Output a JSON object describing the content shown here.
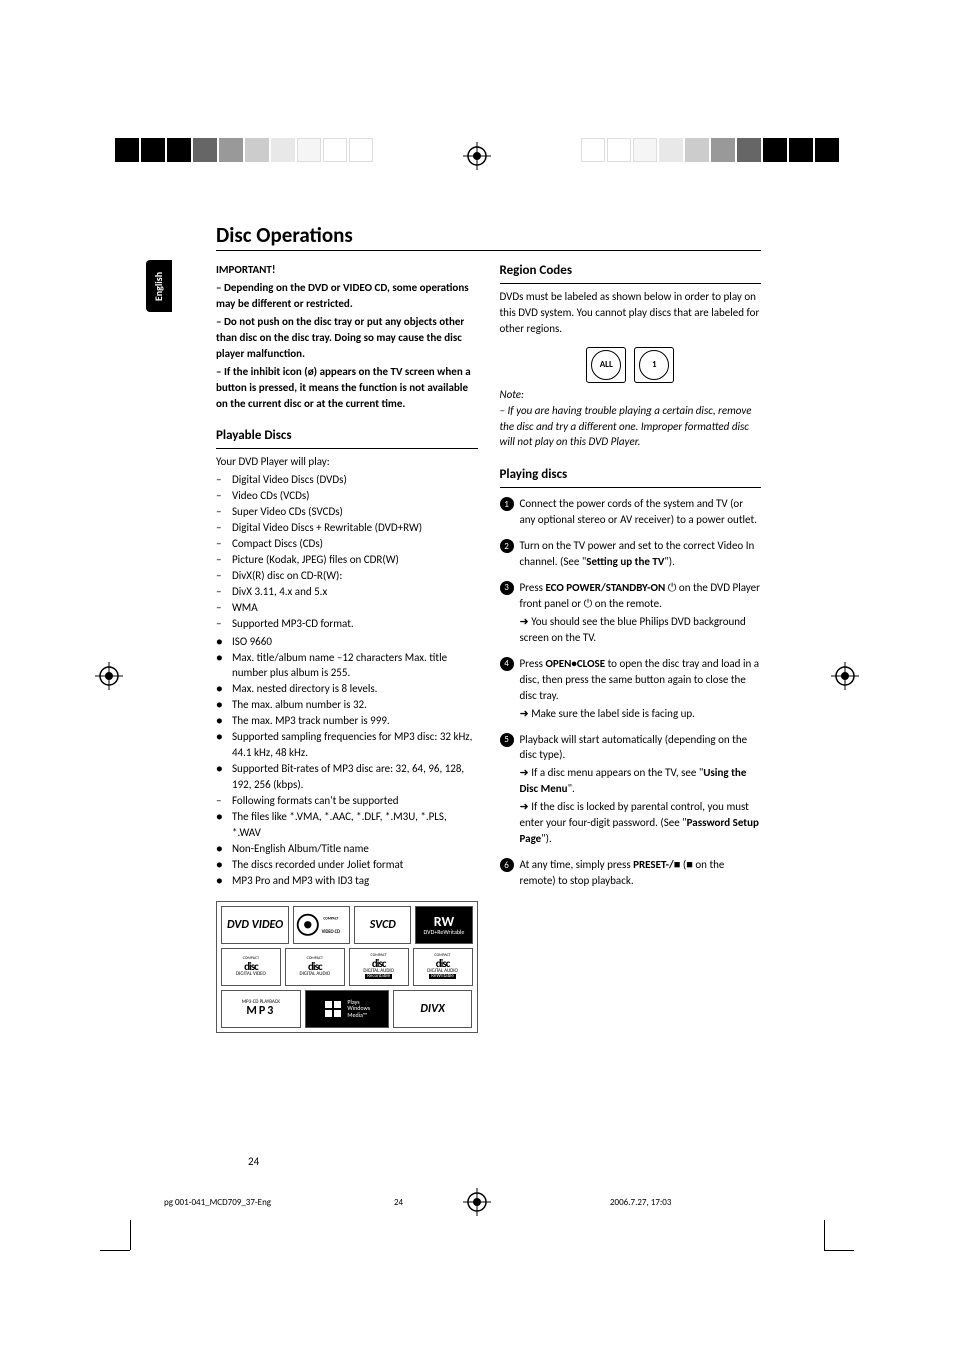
{
  "lang_tab": "English",
  "page_title": "Disc Operations",
  "important": {
    "heading": "IMPORTANT!",
    "p1": "–   Depending on the DVD or VIDEO CD, some operations may be different or restricted.",
    "p2": "–   Do not push on the disc tray or put any objects other than disc on the disc tray. Doing so may cause the disc player malfunction.",
    "p3": "–   If the inhibit icon (ø) appears on the TV screen when a button is pressed, it means the function is not available on the current disc or at the current time."
  },
  "playable": {
    "heading": "Playable Discs",
    "intro": "Your DVD Player will play:",
    "list1": [
      "Digital Video Discs (DVDs)",
      "Video CDs (VCDs)",
      "Super Video CDs (SVCDs)",
      "Digital Video Discs + Rewritable (DVD+RW)",
      "Compact Discs (CDs)",
      "Picture (Kodak, JPEG) files on CDR(W)",
      "DivX(R) disc on CD-R(W):",
      "DivX 3.11, 4.x and 5.x",
      "WMA",
      "Supported MP3-CD format."
    ],
    "list2": [
      "ISO 9660",
      "Max. title/album name –12 characters Max. title number plus album is 255.",
      "Max. nested directory is 8 levels.",
      "The max. album number is 32.",
      "The max. MP3 track number is 999.",
      "Supported sampling frequencies for MP3 disc: 32 kHz, 44.1 kHz, 48 kHz.",
      "Supported Bit-rates of MP3 disc are: 32, 64, 96, 128, 192, 256 (kbps).",
      "Following formats can't be supported",
      "The files like *.VMA, *.AAC, *.DLF, *.M3U, *.PLS, *.WAV",
      "Non-English Album/Title name",
      "The discs recorded under Joliet format",
      "MP3 Pro and MP3 with ID3 tag"
    ],
    "list2_markers": [
      "●",
      "●",
      "●",
      "●",
      "●",
      "●",
      "●",
      "–",
      "●",
      "●",
      "●",
      "●"
    ]
  },
  "logos": {
    "r1": [
      "DVD VIDEO",
      "VIDEO CD",
      "SVCD",
      "DVD+ReWritable"
    ],
    "r2": [
      "COMPACT disc DIGITAL VIDEO",
      "COMPACT disc DIGITAL AUDIO",
      "COMPACT disc DIGITAL AUDIO Recordable",
      "COMPACT disc DIGITAL AUDIO ReWritable"
    ],
    "r3": [
      "MP3-CD PLAYBACK MP3",
      "Plays Windows Media™",
      "DIVX"
    ]
  },
  "region": {
    "heading": "Region Codes",
    "p1": "DVDs must be labeled as shown below in order to play on this DVD system. You cannot play discs that are labeled for other regions.",
    "icon1": "ALL",
    "icon2": "1",
    "note_head": "Note:",
    "note_body": "–   If you are having trouble playing a certain disc, remove the disc and try a different one. Improper formatted disc will not play on this DVD Player."
  },
  "playing": {
    "heading": "Playing discs",
    "steps": [
      {
        "num": "1",
        "lines": [
          {
            "t": "plain",
            "text": "Connect the power cords of the system and TV (or any optional stereo or AV receiver) to a power outlet."
          }
        ]
      },
      {
        "num": "2",
        "lines": [
          {
            "t": "mixed",
            "pre": "Turn on the TV power and set to the correct Video In channel. (See \"",
            "bold": "Setting up the TV",
            "post": "\")."
          }
        ]
      },
      {
        "num": "3",
        "lines": [
          {
            "t": "mixed",
            "pre": "Press ",
            "bold": "ECO POWER/STANDBY-ON",
            "post": " ⏻ on the DVD Player front panel or ⏻ on the remote."
          },
          {
            "t": "arrow",
            "text": "You should see the blue Philips DVD background screen on the TV."
          }
        ]
      },
      {
        "num": "4",
        "lines": [
          {
            "t": "mixed",
            "pre": "Press ",
            "bold": "OPEN•CLOSE",
            "post": " to open the disc tray and load in a disc, then press the same button again to close the disc tray."
          },
          {
            "t": "arrow",
            "text": "Make sure the label side is facing up."
          }
        ]
      },
      {
        "num": "5",
        "lines": [
          {
            "t": "plain",
            "text": "Playback will start automatically (depending on the disc type)."
          },
          {
            "t": "arrow_mixed",
            "pre": "If a disc menu appears on the TV, see \"",
            "bold": "Using the Disc Menu",
            "post": "\"."
          },
          {
            "t": "arrow_mixed",
            "pre": "If the disc is locked by parental control, you must enter your four-digit password. (See \"",
            "bold": "Password Setup Page",
            "post": "\")."
          }
        ]
      },
      {
        "num": "6",
        "lines": [
          {
            "t": "mixed",
            "pre": "At any time, simply press ",
            "bold": "PRESET-/■",
            "post": " (■ on the remote) to stop playback."
          }
        ]
      }
    ]
  },
  "page_number": "24",
  "footer": {
    "filename": "pg 001-041_MCD709_37-Eng",
    "page": "24",
    "date": "2006.7.27, 17:03"
  }
}
